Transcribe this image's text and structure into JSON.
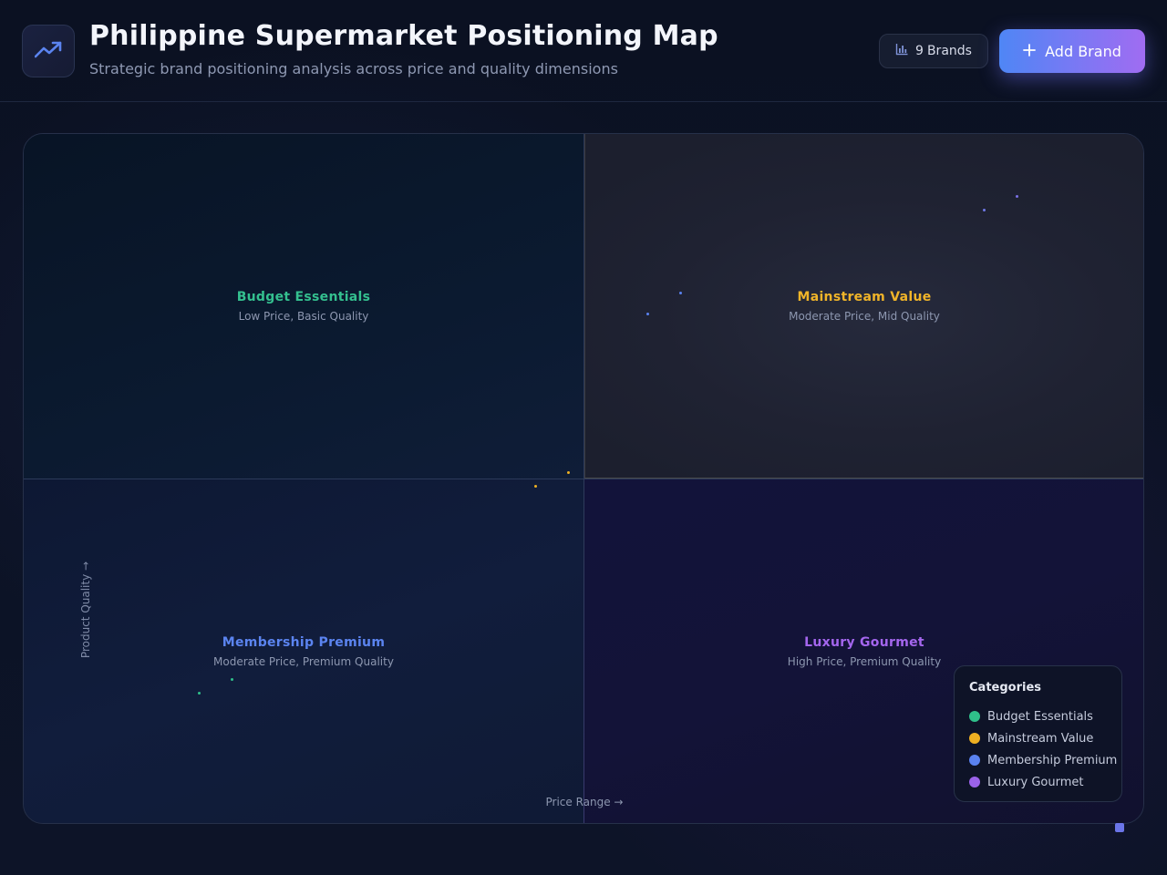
{
  "header": {
    "title": "Philippine Supermarket Positioning Map",
    "subtitle": "Strategic brand positioning analysis across price and quality dimensions",
    "logo_icon": "trending-up-icon",
    "brands_count": "9",
    "brands_label": "Brands",
    "brands_icon": "bar-chart-icon",
    "add_button_label": "Add Brand",
    "add_button_icon": "plus-icon"
  },
  "map": {
    "y_axis_label": "Product Quality →",
    "x_axis_label": "Price Range →",
    "quadrants": [
      {
        "name": "Budget Essentials",
        "description": "Low Price, Basic Quality",
        "color": "#34c08f"
      },
      {
        "name": "Mainstream Value",
        "description": "Moderate Price, Mid Quality",
        "color": "#f0b429"
      },
      {
        "name": "Membership Premium",
        "description": "Moderate Price, Premium Quality",
        "color": "#5b84f0"
      },
      {
        "name": "Luxury Gourmet",
        "description": "High Price, Premium Quality",
        "color": "#a466ee"
      }
    ]
  },
  "legend": {
    "title": "Categories",
    "items": [
      {
        "label": "Budget Essentials",
        "color": "#2fbf8a"
      },
      {
        "label": "Mainstream Value",
        "color": "#eeb022"
      },
      {
        "label": "Membership Premium",
        "color": "#5a82f0"
      },
      {
        "label": "Luxury Gourmet",
        "color": "#9b62ea"
      }
    ]
  },
  "colors": {
    "accent_start": "#4f86f5",
    "accent_end": "#a06cf2",
    "background": "#0c1224"
  }
}
